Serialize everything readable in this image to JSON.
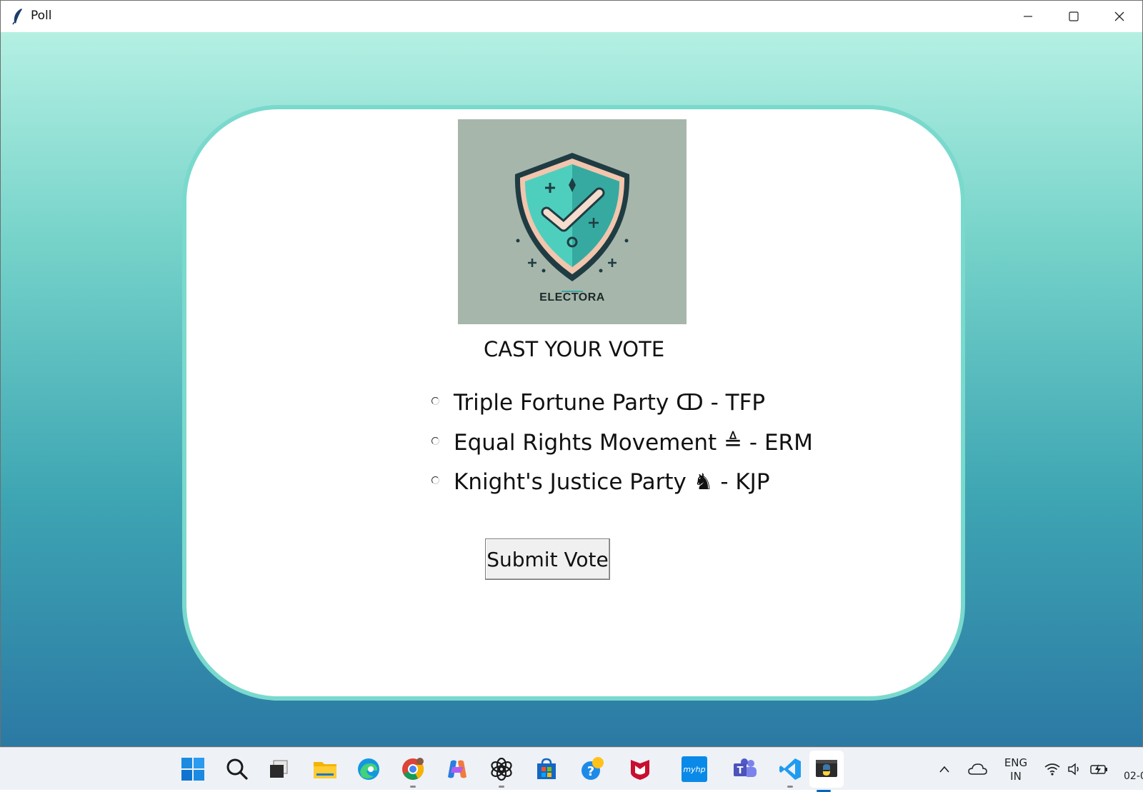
{
  "window": {
    "title": "Poll",
    "app_icon": "feather-icon",
    "controls": [
      "minimize-icon",
      "maximize-icon",
      "close-icon"
    ]
  },
  "logo": {
    "text": "ELECTORA",
    "icon": "shield-check-icon"
  },
  "poll": {
    "heading": "CAST YOUR VOTE",
    "options": [
      {
        "label": "Triple Fortune Party ↀ - TFP",
        "selected": false
      },
      {
        "label": "Equal Rights Movement ≜ - ERM",
        "selected": false
      },
      {
        "label": "Knight's Justice Party ♞ - KJP",
        "selected": false
      }
    ],
    "submit_label": "Submit Vote"
  },
  "taskbar": {
    "apps": [
      "windows-start-icon",
      "search-icon",
      "task-view-icon",
      "file-explorer-icon",
      "edge-icon",
      "chrome-icon",
      "copilot-icon",
      "chatgpt-icon",
      "microsoft-store-icon",
      "get-help-icon",
      "mcafee-icon",
      "myhp-icon",
      "teams-icon",
      "vscode-icon",
      "python-icon"
    ],
    "myhp_label": "myhp",
    "tray": {
      "language_line1": "ENG",
      "language_line2": "IN",
      "clock": "02-0"
    }
  },
  "colors": {
    "gradient_top": "#b4f0e3",
    "gradient_bottom": "#2b79a4",
    "card_border": "#7ad9cd",
    "card_bg": "#ffffff",
    "logo_bg": "#a7b6ab"
  }
}
